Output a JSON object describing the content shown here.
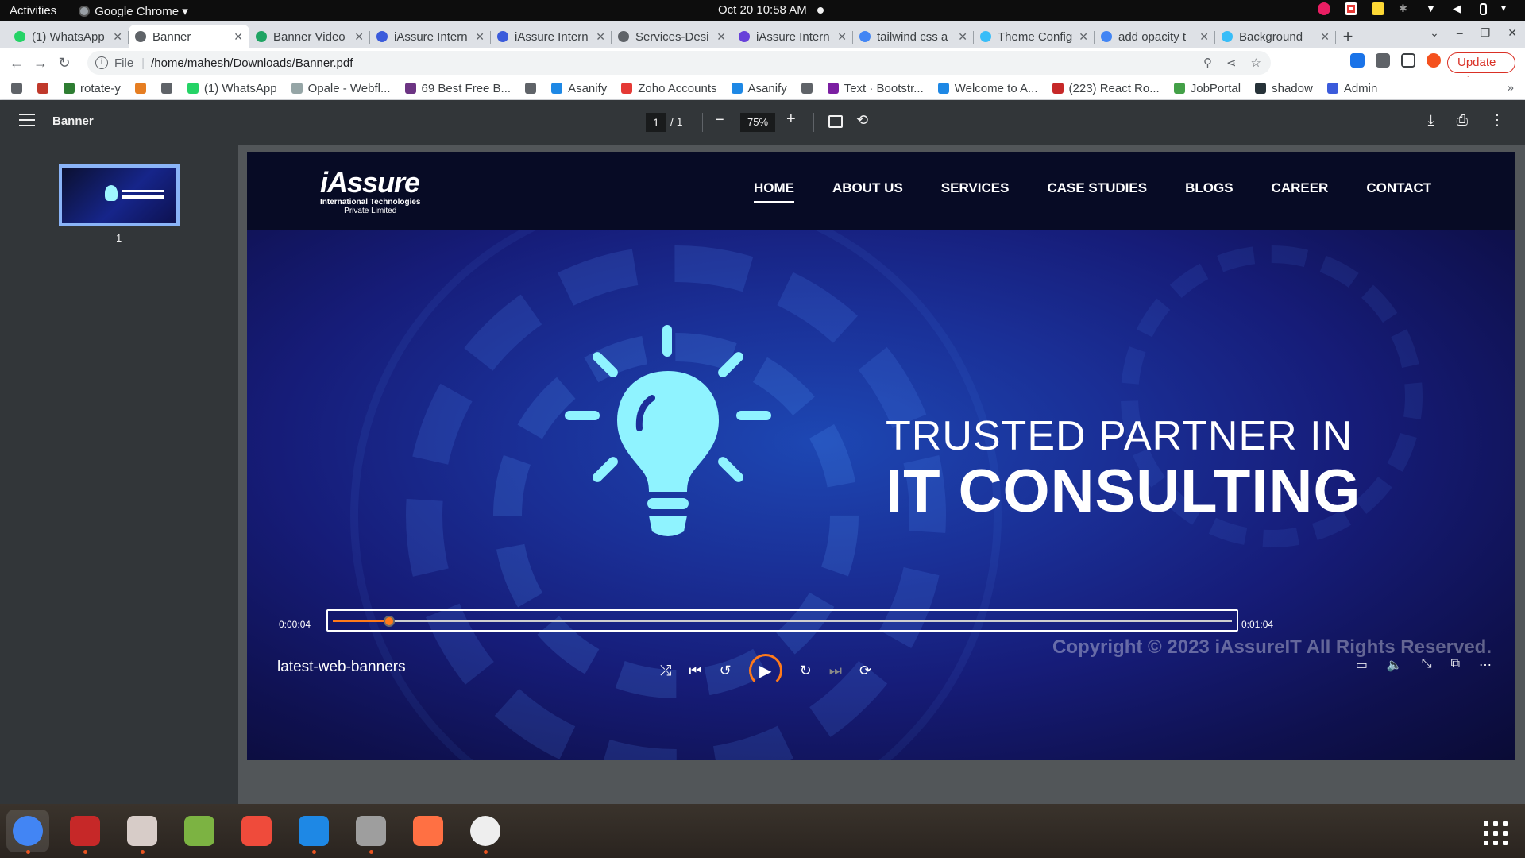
{
  "system": {
    "activities": "Activities",
    "app_name": "Google Chrome ▾",
    "clock": "Oct 20  10:58 AM"
  },
  "tabs": [
    {
      "title": "(1) WhatsApp",
      "favicon_color": "#25d366"
    },
    {
      "title": "Banner",
      "favicon_color": "#5f6368",
      "active": true
    },
    {
      "title": "Banner Video",
      "favicon_color": "#1fa463"
    },
    {
      "title": "iAssure Intern",
      "favicon_color": "#3b5bdb"
    },
    {
      "title": "iAssure Intern",
      "favicon_color": "#3b5bdb"
    },
    {
      "title": "Services-Desi",
      "favicon_color": "#5f6368"
    },
    {
      "title": "iAssure Intern",
      "favicon_color": "#6741d9"
    },
    {
      "title": "tailwind css a",
      "favicon_color": "#4285f4"
    },
    {
      "title": "Theme Config",
      "favicon_color": "#38bdf8"
    },
    {
      "title": "add opacity t",
      "favicon_color": "#4285f4"
    },
    {
      "title": "Background",
      "favicon_color": "#38bdf8"
    }
  ],
  "address": {
    "scheme": "File",
    "url": "/home/mahesh/Downloads/Banner.pdf",
    "update_label": "Update"
  },
  "bookmarks": [
    {
      "label": "",
      "color": "#5f6368"
    },
    {
      "label": "",
      "color": "#c0392b"
    },
    {
      "label": "rotate-y",
      "color": "#2e7d32"
    },
    {
      "label": "",
      "color": "#e67e22"
    },
    {
      "label": "",
      "color": "#5f6368"
    },
    {
      "label": "(1) WhatsApp",
      "color": "#25d366"
    },
    {
      "label": "Opale - Webfl...",
      "color": "#95a5a6"
    },
    {
      "label": "69 Best Free B...",
      "color": "#6c3483"
    },
    {
      "label": "",
      "color": "#5f6368"
    },
    {
      "label": "Asanify",
      "color": "#1e88e5"
    },
    {
      "label": "Zoho Accounts",
      "color": "#e53935"
    },
    {
      "label": "Asanify",
      "color": "#1e88e5"
    },
    {
      "label": "",
      "color": "#5f6368"
    },
    {
      "label": "Text · Bootstr...",
      "color": "#7b1fa2"
    },
    {
      "label": "Welcome to A...",
      "color": "#1e88e5"
    },
    {
      "label": "(223) React Ro...",
      "color": "#c62828"
    },
    {
      "label": "JobPortal",
      "color": "#43a047"
    },
    {
      "label": "shadow",
      "color": "#263238"
    },
    {
      "label": "Admin",
      "color": "#3b5bdb"
    }
  ],
  "pdf": {
    "doc_title": "Banner",
    "page_current": "1",
    "page_total": "/   1",
    "zoom": "75%",
    "thumb_label": "1"
  },
  "banner": {
    "logo_brand": "iAssure",
    "logo_sub1": "International Technologies",
    "logo_sub2": "Private Limited",
    "nav": [
      "HOME",
      "ABOUT US",
      "SERVICES",
      "CASE STUDIES",
      "BLOGS",
      "CAREER",
      "CONTACT"
    ],
    "headline1": "TRUSTED PARTNER IN",
    "headline2": "IT CONSULTING",
    "bulb_color": "#8ff3ff"
  },
  "player": {
    "current_time": "0:00:04",
    "end_time": "0:01:04",
    "progress_fraction": 0.0625,
    "copyright": "Copyright © 2023 iAssureIT All Rights Reserved.",
    "video_title": "latest-web-banners",
    "accent": "#ff7a1a"
  },
  "dock": [
    {
      "name": "chrome",
      "color": "#4285f4",
      "running": true
    },
    {
      "name": "terminal",
      "color": "#c62828",
      "running": true
    },
    {
      "name": "files",
      "color": "#d7ccc8",
      "running": true
    },
    {
      "name": "text-editor",
      "color": "#7cb342",
      "running": false
    },
    {
      "name": "anydesk",
      "color": "#ef4b3b",
      "running": false
    },
    {
      "name": "vscode",
      "color": "#1e88e5",
      "running": true
    },
    {
      "name": "search",
      "color": "#9e9e9e",
      "running": true
    },
    {
      "name": "pen-tool",
      "color": "#ff7043",
      "running": false
    },
    {
      "name": "recorder",
      "color": "#eeeeee",
      "running": true
    }
  ]
}
